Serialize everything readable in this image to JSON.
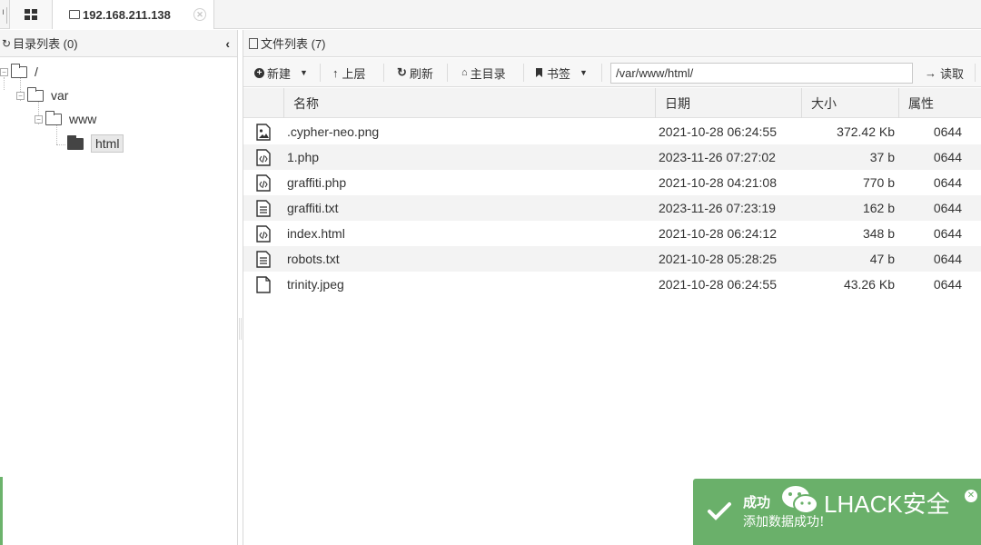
{
  "topbar": {
    "tabs": [
      {
        "label": ""
      },
      {
        "label": "192.168.211.138"
      }
    ]
  },
  "left_panel": {
    "title": "目录列表 (0)",
    "tree": [
      {
        "label": "/"
      },
      {
        "label": "var"
      },
      {
        "label": "www"
      },
      {
        "label": "html"
      }
    ]
  },
  "right_panel": {
    "title": "文件列表 (7)",
    "toolbar": {
      "new_label": "新建",
      "up_label": "上层",
      "refresh_label": "刷新",
      "home_label": "主目录",
      "bookmark_label": "书签",
      "path_value": "/var/www/html/",
      "read_label": "读取"
    },
    "columns": [
      "名称",
      "日期",
      "大小",
      "属性"
    ],
    "files": [
      {
        "name": ".cypher-neo.png",
        "date": "2021-10-28 06:24:55",
        "size": "372.42 Kb",
        "attr": "0644",
        "icon": "image-file-icon"
      },
      {
        "name": "1.php",
        "date": "2023-11-26 07:27:02",
        "size": "37 b",
        "attr": "0644",
        "icon": "code-file-icon"
      },
      {
        "name": "graffiti.php",
        "date": "2021-10-28 04:21:08",
        "size": "770 b",
        "attr": "0644",
        "icon": "code-file-icon"
      },
      {
        "name": "graffiti.txt",
        "date": "2023-11-26 07:23:19",
        "size": "162 b",
        "attr": "0644",
        "icon": "text-file-icon"
      },
      {
        "name": "index.html",
        "date": "2021-10-28 06:24:12",
        "size": "348 b",
        "attr": "0644",
        "icon": "code-file-icon"
      },
      {
        "name": "robots.txt",
        "date": "2021-10-28 05:28:25",
        "size": "47 b",
        "attr": "0644",
        "icon": "text-file-icon"
      },
      {
        "name": "trinity.jpeg",
        "date": "2021-10-28 06:24:55",
        "size": "43.26 Kb",
        "attr": "0644",
        "icon": "blank-file-icon"
      }
    ]
  },
  "toast": {
    "title": "成功",
    "message": "添加数据成功!",
    "brand": "LHACK安全",
    "color": "#6ab06a"
  }
}
